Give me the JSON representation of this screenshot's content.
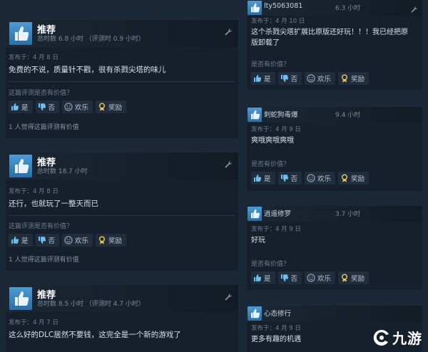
{
  "helpful_question": "这篇评测是否有价值？",
  "helpful_question_short": "是否有价值？",
  "buttons": {
    "yes": "是",
    "no": "否",
    "funny": "欢乐",
    "award": "奖励"
  },
  "left_reviews": [
    {
      "title": "推荐",
      "hours": "总时数 6.8 小时 （评测时 0.9 小时）",
      "date": "发布于：4 月 8 日",
      "text": "免费的不说，质量针不戳，很有杀戮尖塔的味儿",
      "count": "1 人觉得这篇评测有价值"
    },
    {
      "title": "推荐",
      "hours": "总时数 18.7 小时",
      "date": "发布于：4 月 8 日",
      "text": "还行，也就玩了一整天而已",
      "count": "1 人觉得这篇评测有价值"
    },
    {
      "title": "推荐",
      "hours": "总时数 8.5 小时 （评测时 4.7 小时）",
      "date": "发布于：4 月 7 日",
      "text": "这么好的DLC居然不要钱，这完全是一个新的游戏了"
    }
  ],
  "right_reviews": [
    {
      "user": "lty5063081",
      "hours": "6.3 小时",
      "date": "发布于：4 月 10 日",
      "text1": "这个杀戮尖塔扩展比原版还好玩！！！我已经把原",
      "text2": "版卸载了"
    },
    {
      "user": "刺蛇狗毒爆",
      "hours": "9.4 小时",
      "date": "发布于：4 月 9 日",
      "text1": "爽哦爽哦爽哦"
    },
    {
      "user": "逍遥修罗",
      "hours": "3.7 小时",
      "date": "发布于：4 月 9 日",
      "text1": "好玩"
    },
    {
      "user": "心态修行",
      "date": "发布于：4 月 9 日",
      "text1": "更多有趣的机遇"
    }
  ],
  "watermark": "九游"
}
